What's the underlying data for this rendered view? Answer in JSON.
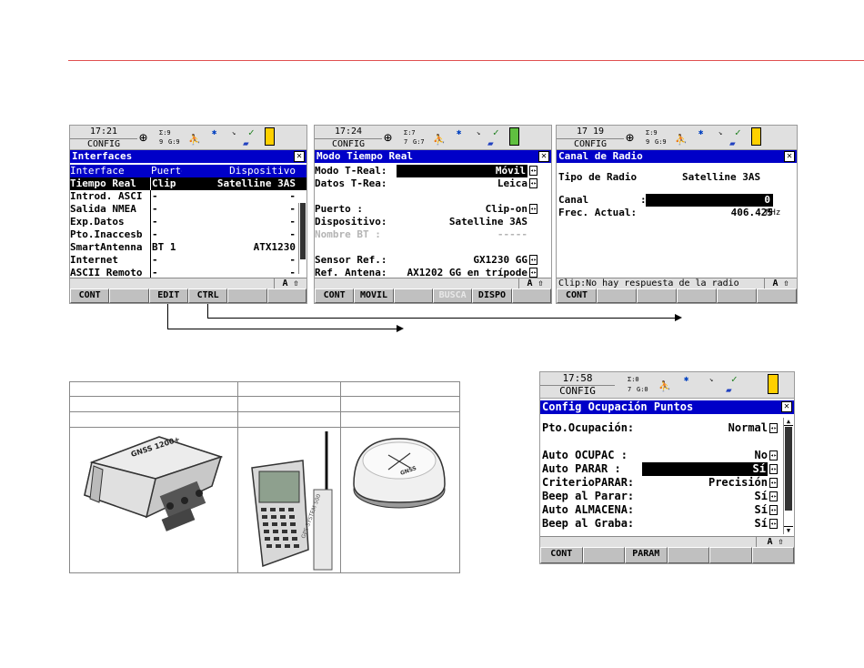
{
  "screens": {
    "interfaces": {
      "time": "17:21",
      "mode": "CONFIG",
      "status": {
        "sats_top": "Σ:9",
        "sats_left": "9",
        "sats_right": "G:9"
      },
      "title": "Interfaces",
      "header": {
        "col1": "Interface",
        "col2": "Puerto",
        "col3": "Dispositivo"
      },
      "rows": [
        {
          "interface": "Tiempo Real",
          "port": "Clip",
          "device": "Satelline 3AS"
        },
        {
          "interface": "Introd. ASCI",
          "port": "-",
          "device": "-"
        },
        {
          "interface": "Salida NMEA",
          "port": "-",
          "device": "-"
        },
        {
          "interface": "Exp.Datos",
          "port": "-",
          "device": "-"
        },
        {
          "interface": "Pto.Inaccesb",
          "port": "-",
          "device": "-"
        },
        {
          "interface": "SmartAntenna",
          "port": "BT 1",
          "device": "ATX1230"
        },
        {
          "interface": "Internet",
          "port": "-",
          "device": "-"
        },
        {
          "interface": "ASCII Remoto",
          "port": "-",
          "device": "-"
        }
      ],
      "hint": "",
      "hint_right": "A ⇧",
      "fkeys": [
        "CONT",
        "",
        "EDIT",
        "CTRL",
        "",
        ""
      ]
    },
    "modo_tiempo_real": {
      "time": "17:24",
      "mode": "CONFIG",
      "status": {
        "sats_top": "Σ:7",
        "sats_left": "7",
        "sats_right": "G:7"
      },
      "title": "Modo Tiempo Real",
      "fields": [
        {
          "label": "Modo T-Real:",
          "value": "Móvil",
          "selected": true
        },
        {
          "label": "Datos T-Rea:",
          "value": "Leica"
        },
        {
          "label": "",
          "value": ""
        },
        {
          "label": "Puerto     :",
          "value": "Clip-on"
        },
        {
          "label": "Dispositivo:",
          "value": "Satelline 3AS"
        },
        {
          "label": "Nombre BT  :",
          "value": "-----",
          "grey": true
        },
        {
          "label": "",
          "value": ""
        },
        {
          "label": "Sensor Ref.:",
          "value": "GX1230 GG"
        },
        {
          "label": "Ref. Antena:",
          "value": "AX1202 GG en trípode"
        }
      ],
      "hint": "",
      "hint_right": "A ⇧",
      "fkeys": [
        "CONT",
        "MOVIL",
        "",
        "BUSCA",
        "DISPO",
        ""
      ]
    },
    "canal_radio": {
      "time": "17 19",
      "mode": "CONFIG",
      "status": {
        "sats_top": "Σ:9",
        "sats_left": "9",
        "sats_right": "G:9"
      },
      "title": "Canal de Radio",
      "radio_label": "Tipo de Radio",
      "radio_value": "Satelline 3AS",
      "canal_label": "Canal",
      "canal_value": "0",
      "freq_label": "Frec. Actual:",
      "freq_value": "406.425",
      "freq_unit": "MHz",
      "hint": "Clip:No hay respuesta de la radio",
      "hint_right": "A ⇧",
      "fkeys": [
        "CONT",
        "",
        "",
        "",
        "",
        ""
      ]
    },
    "ocupacion": {
      "time": "17:58",
      "mode": "CONFIG",
      "status": {
        "sats_top": "Σ:0",
        "sats_left": "7",
        "sats_right": "G:0"
      },
      "title": "Config Ocupación Puntos",
      "fields": [
        {
          "label": "Pto.Ocupación:",
          "value": "Normal"
        },
        {
          "label": "",
          "value": ""
        },
        {
          "label": "Auto OCUPAC  :",
          "value": "No"
        },
        {
          "label": "Auto PARAR   :",
          "value": "Sí",
          "selected": true
        },
        {
          "label": "CriterioPARAR:",
          "value": "Precisión"
        },
        {
          "label": "Beep al Parar:",
          "value": "Sí"
        },
        {
          "label": "Auto ALMACENA:",
          "value": "Sí"
        },
        {
          "label": "Beep al Graba:",
          "value": "Sí"
        }
      ],
      "hint_right": "A ⇧",
      "fkeys": [
        "CONT",
        "",
        "PARAM",
        "",
        "",
        ""
      ]
    }
  }
}
